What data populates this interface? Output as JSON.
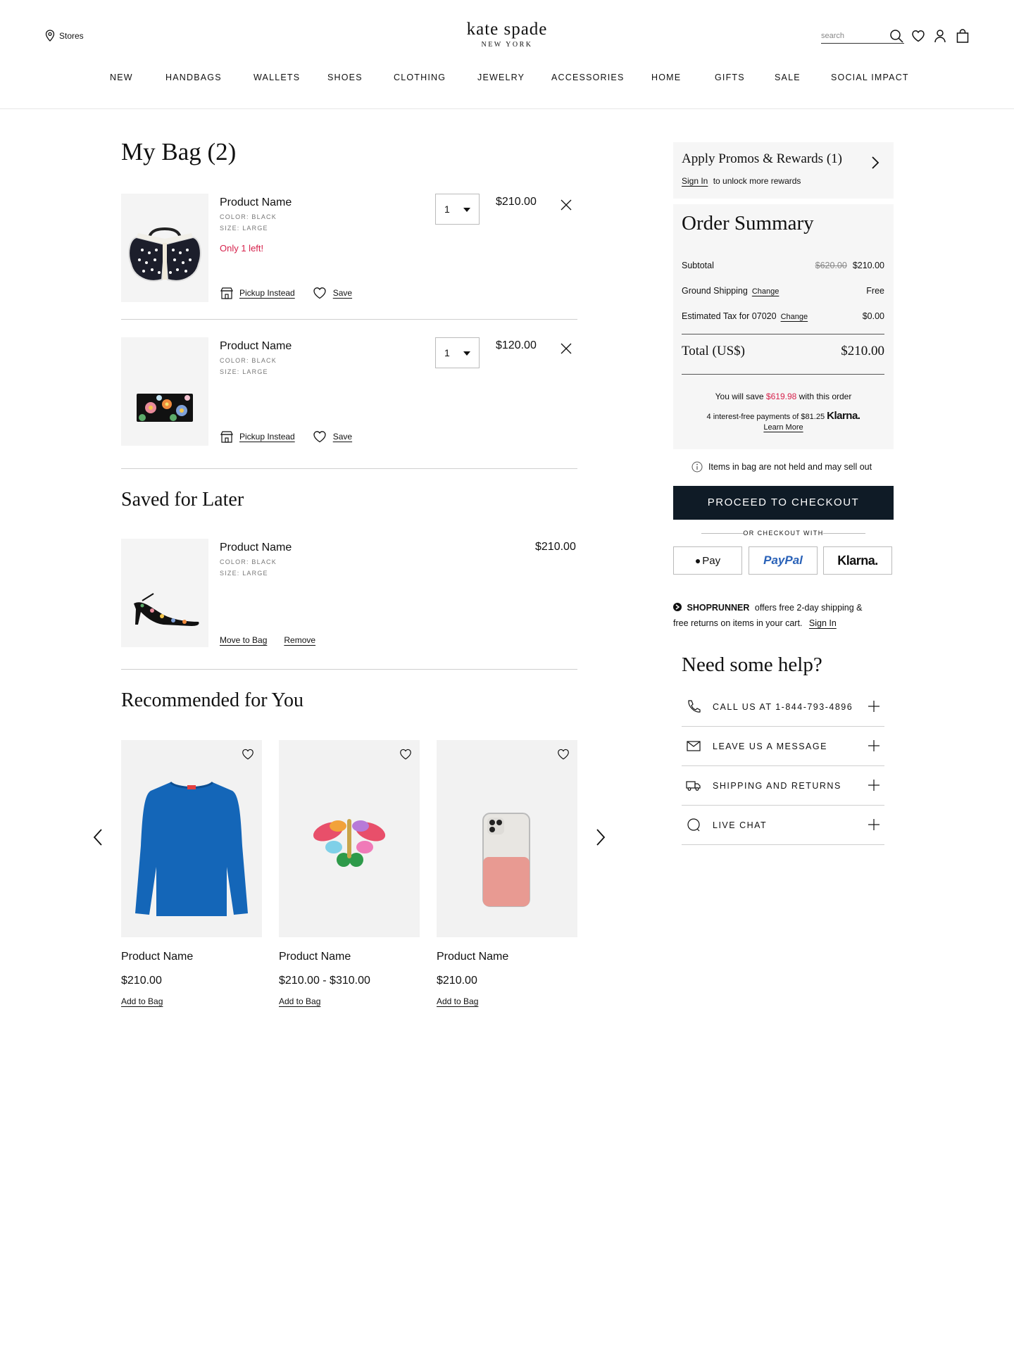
{
  "header": {
    "stores_label": "Stores",
    "brand": "kate spade",
    "brand_sub": "NEW YORK",
    "search_placeholder": "search"
  },
  "nav": [
    "NEW",
    "HANDBAGS",
    "WALLETS",
    "SHOES",
    "CLOTHING",
    "JEWELRY",
    "ACCESSORIES",
    "HOME",
    "GIFTS",
    "SALE",
    "SOCIAL IMPACT"
  ],
  "bag": {
    "title": "My Bag (2)",
    "items": [
      {
        "name": "Product Name",
        "color": "COLOR: BLACK",
        "size": "SIZE: LARGE",
        "stock": "Only 1 left!",
        "qty": "1",
        "price": "$210.00",
        "pickup": "Pickup Instead",
        "save": "Save",
        "image": "butterfly-handbag"
      },
      {
        "name": "Product Name",
        "color": "COLOR: BLACK",
        "size": "SIZE: LARGE",
        "stock": "",
        "qty": "1",
        "price": "$120.00",
        "pickup": "Pickup Instead",
        "save": "Save",
        "image": "floral-wallet"
      }
    ]
  },
  "saved": {
    "title": "Saved for Later",
    "items": [
      {
        "name": "Product Name",
        "color": "COLOR: BLACK",
        "size": "SIZE: LARGE",
        "price": "$210.00",
        "move": "Move to Bag",
        "remove": "Remove",
        "image": "floral-heel"
      }
    ]
  },
  "recommended": {
    "title": "Recommended for You",
    "items": [
      {
        "name": "Product Name",
        "price": "$210.00",
        "add": "Add to Bag",
        "image": "blue-sweater"
      },
      {
        "name": "Product Name",
        "price": "$210.00 - $310.00",
        "add": "Add to Bag",
        "image": "jeweled-butterfly-pin"
      },
      {
        "name": "Product Name",
        "price": "$210.00",
        "add": "Add to Bag",
        "image": "pink-phone-case"
      }
    ]
  },
  "promo": {
    "title": "Apply Promos & Rewards (1)",
    "signin": "Sign In",
    "subtitle": "to unlock more rewards"
  },
  "summary": {
    "title": "Order Summary",
    "subtotal_label": "Subtotal",
    "subtotal_original": "$620.00",
    "subtotal_value": "$210.00",
    "shipping_label": "Ground Shipping",
    "shipping_change": "Change",
    "shipping_value": "Free",
    "tax_label": "Estimated Tax for 07020",
    "tax_change": "Change",
    "tax_value": "$0.00",
    "total_label": "Total (US$)",
    "total_value": "$210.00",
    "save_pre": "You will save",
    "save_amount": "$619.98",
    "save_post": "with this order",
    "klarna_text": "4 interest-free payments of $81.25",
    "klarna_brand": "Klarna.",
    "learn_more": "Learn More"
  },
  "notice": "Items in bag are not held and may sell out",
  "checkout": {
    "button": "PROCEED TO CHECKOUT",
    "or_with": "OR CHECKOUT WITH",
    "applepay": "Pay",
    "paypal": "PayPal",
    "klarna": "Klarna."
  },
  "shoprunner": {
    "brand": "SHOPRUNNER",
    "text1": "offers free 2-day shipping &",
    "text2": "free returns on items in your cart.",
    "signin": "Sign In"
  },
  "help": {
    "title": "Need some help?",
    "rows": [
      {
        "label": "CALL US AT 1-844-793-4896",
        "icon": "phone-icon"
      },
      {
        "label": "LEAVE US A MESSAGE",
        "icon": "envelope-icon"
      },
      {
        "label": "SHIPPING AND RETURNS",
        "icon": "truck-icon"
      },
      {
        "label": "LIVE CHAT",
        "icon": "chat-bubble-icon"
      }
    ]
  },
  "colors": {
    "accent_red": "#d6224c",
    "checkout_bg": "#0f1b26",
    "panel_bg": "#f6f6f6"
  }
}
